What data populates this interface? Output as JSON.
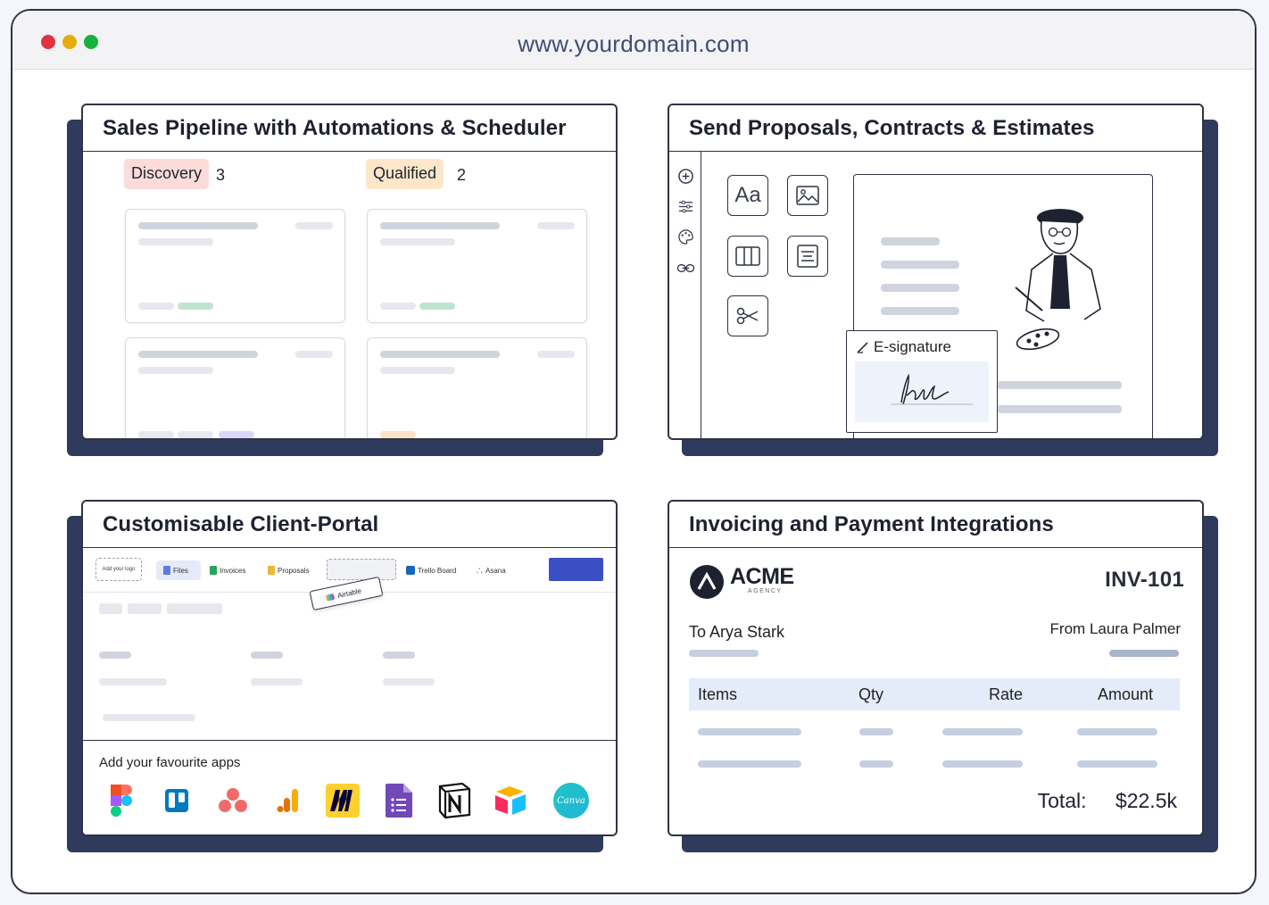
{
  "browser": {
    "url": "www.yourdomain.com",
    "dots": [
      "#e0333d",
      "#e3ae0c",
      "#18b13e"
    ]
  },
  "pipeline": {
    "title": "Sales Pipeline with Automations & Scheduler",
    "stages": [
      {
        "label": "Discovery",
        "count": "3",
        "color": "#fbdcd8"
      },
      {
        "label": "Qualified",
        "count": "2",
        "color": "#fde6c9"
      }
    ]
  },
  "proposals": {
    "title": "Send Proposals, Contracts & Estimates",
    "esignature_label": "E-signature",
    "font_tool_label": "Aa"
  },
  "portal": {
    "title": "Customisable Client-Portal",
    "logo_placeholder": "Add your logo",
    "tabs": [
      "Files",
      "Invoices",
      "Proposals",
      "Trello Board",
      "Asana"
    ],
    "dragging_tab": "Airtable",
    "apps_heading": "Add your favourite apps",
    "apps": [
      "figma-icon",
      "trello-icon",
      "asana-icon",
      "analytics-icon",
      "miro-icon",
      "google-forms-icon",
      "notion-icon",
      "airtable-icon",
      "canva-icon"
    ],
    "canva_label": "Canva"
  },
  "invoice": {
    "title": "Invoicing and Payment Integrations",
    "brand": "ACME",
    "brand_sub": "AGENCY",
    "number": "INV-101",
    "to_label": "To",
    "to_name": "Arya Stark",
    "from_label": "From",
    "from_name": "Laura Palmer",
    "columns": [
      "Items",
      "Qty",
      "Rate",
      "Amount"
    ],
    "total_label": "Total:",
    "total_value": "$22.5k"
  }
}
